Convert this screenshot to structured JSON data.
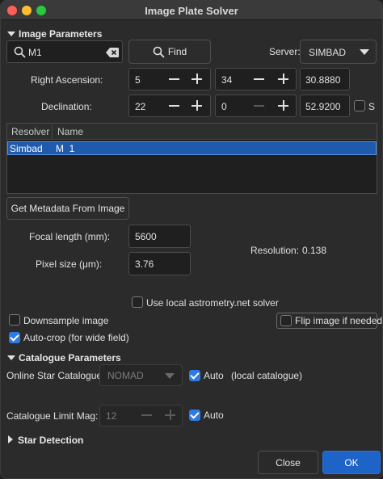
{
  "window": {
    "title": "Image Plate Solver"
  },
  "image_params": {
    "header": "Image Parameters",
    "search": {
      "value": "M1"
    },
    "find_label": "Find",
    "server_label": "Server:",
    "server_value": "SIMBAD",
    "ra": {
      "label": "Right Ascension:",
      "h": "5",
      "m": "34",
      "s": "30.8880"
    },
    "dec": {
      "label": "Declination:",
      "d": "22",
      "m": "0",
      "s": "52.9200",
      "sign_label": "S"
    }
  },
  "results": {
    "columns": [
      "Resolver",
      "Name"
    ],
    "rows": [
      {
        "resolver": "Simbad",
        "name": "M  1"
      }
    ]
  },
  "metadata": {
    "button_label": "Get Metadata From Image",
    "focal_label": "Focal length (mm):",
    "focal_value": "5600",
    "pixel_label": "Pixel size (μm):",
    "pixel_value": "3.76",
    "resolution_label": "Resolution:",
    "resolution_value": "0.138"
  },
  "options": {
    "use_local_label": "Use local astrometry.net solver",
    "use_local_checked": false,
    "downsample_label": "Downsample image",
    "downsample_checked": false,
    "flip_label": "Flip image if needed",
    "flip_checked": false,
    "autocrop_label": "Auto-crop (for wide field)",
    "autocrop_checked": true
  },
  "catalogue": {
    "header": "Catalogue Parameters",
    "online_label": "Online Star Catalogue:",
    "online_value": "NOMAD",
    "auto_label": "Auto",
    "auto_checked": true,
    "local_note": "(local catalogue)",
    "limit_label": "Catalogue Limit Mag:",
    "limit_value": "12",
    "limit_auto_label": "Auto",
    "limit_auto_checked": true
  },
  "star_detection": {
    "header": "Star Detection"
  },
  "footer": {
    "close_label": "Close",
    "ok_label": "OK"
  },
  "colors": {
    "accent": "#1d63c8",
    "selection": "#1f5aad",
    "checkbox": "#2f7ae5"
  }
}
